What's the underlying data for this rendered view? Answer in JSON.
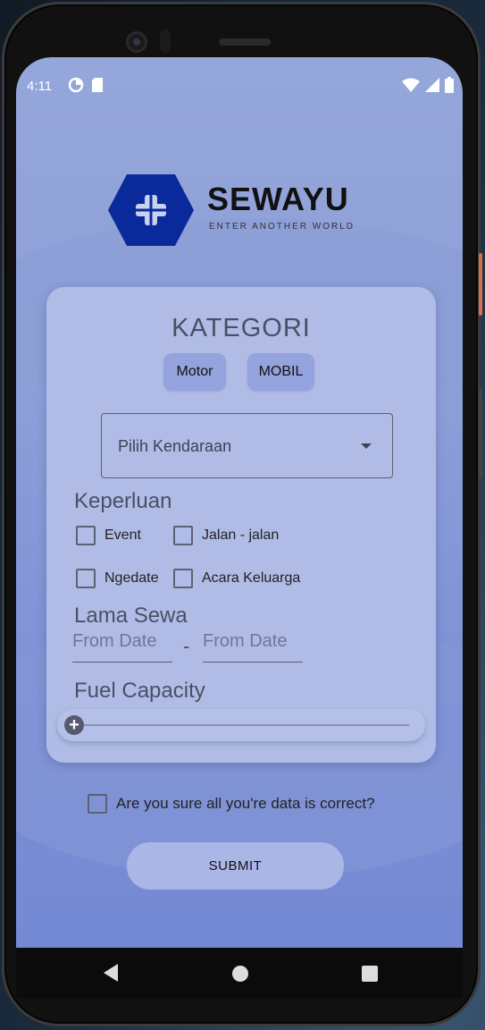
{
  "status_bar": {
    "time": "4:11"
  },
  "logo": {
    "name": "SEWAYU",
    "tagline": "ENTER ANOTHER WORLD",
    "color": "#0a2a9c"
  },
  "form": {
    "title": "KATEGORI",
    "chips": [
      {
        "label": "Motor"
      },
      {
        "label": "MOBIL"
      }
    ],
    "vehicle_select": {
      "placeholder": "Pilih Kendaraan"
    },
    "purpose": {
      "label": "Keperluan",
      "options": [
        {
          "label": "Event",
          "checked": false
        },
        {
          "label": "Jalan - jalan",
          "checked": false
        },
        {
          "label": "Ngedate",
          "checked": false
        },
        {
          "label": "Acara Keluarga",
          "checked": false
        }
      ]
    },
    "duration": {
      "label": "Lama Sewa",
      "from_placeholder": "From Date",
      "separator": "-",
      "to_placeholder": "From Date"
    },
    "fuel": {
      "label": "Fuel Capacity",
      "value": 0
    }
  },
  "confirm": {
    "label": "Are you sure all you're data is correct?",
    "checked": false
  },
  "submit": {
    "label": "SUBMIT"
  },
  "icons": {
    "status_left": [
      "data-saver-icon",
      "sd-card-icon"
    ],
    "status_right": [
      "wifi-icon",
      "signal-icon",
      "battery-icon"
    ],
    "nav": [
      "back-icon",
      "home-icon",
      "recents-icon"
    ]
  }
}
